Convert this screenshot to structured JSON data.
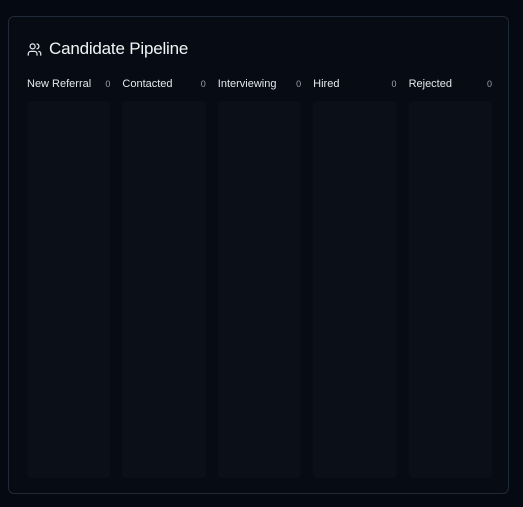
{
  "card": {
    "title": "Candidate Pipeline",
    "icon": "users-icon"
  },
  "columns": [
    {
      "label": "New Referral",
      "count": "0"
    },
    {
      "label": "Contacted",
      "count": "0"
    },
    {
      "label": "Interviewing",
      "count": "0"
    },
    {
      "label": "Hired",
      "count": "0"
    },
    {
      "label": "Rejected",
      "count": "0"
    }
  ],
  "colors": {
    "background": "#050a12",
    "card": "#060b14",
    "border": "#1f2937",
    "column": "#0a0f18",
    "text": "#f3f4f6",
    "muted": "#9ca3af"
  }
}
